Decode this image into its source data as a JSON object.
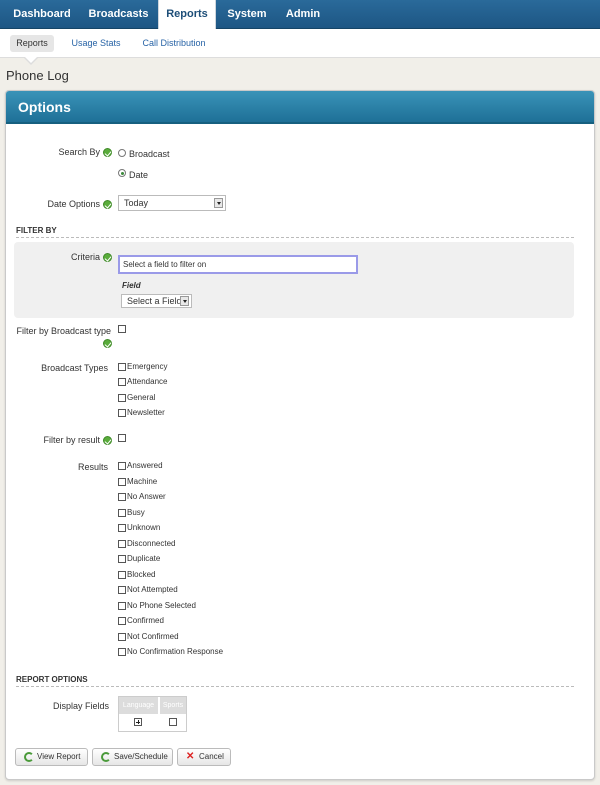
{
  "nav": {
    "tabs": [
      {
        "label": "Dashboard"
      },
      {
        "label": "Broadcasts"
      },
      {
        "label": "Reports"
      },
      {
        "label": "System"
      },
      {
        "label": "Admin"
      }
    ],
    "active_tab": "Reports"
  },
  "subnav": {
    "items": [
      {
        "label": "Reports"
      },
      {
        "label": "Usage Stats"
      },
      {
        "label": "Call Distribution"
      }
    ],
    "active_item": "Reports"
  },
  "page": {
    "title": "Phone Log"
  },
  "panel": {
    "title": "Options"
  },
  "search_by": {
    "label": "Search By",
    "options": [
      {
        "label": "Broadcast",
        "checked": false
      },
      {
        "label": "Date",
        "checked": true
      }
    ]
  },
  "date_options": {
    "label": "Date Options",
    "value": "Today"
  },
  "filter_by": {
    "heading": "FILTER BY",
    "criteria_label": "Criteria",
    "criteria_value": "Select a field to filter on",
    "field_label": "Field",
    "field_select": "Select a Field"
  },
  "broadcast_type_filter": {
    "label": "Filter by Broadcast type",
    "checked": false
  },
  "broadcast_types": {
    "label": "Broadcast Types",
    "items": [
      {
        "label": "Emergency"
      },
      {
        "label": "Attendance"
      },
      {
        "label": "General"
      },
      {
        "label": "Newsletter"
      }
    ]
  },
  "result_filter": {
    "label": "Filter by result",
    "checked": false
  },
  "results": {
    "label": "Results",
    "items": [
      {
        "label": "Answered"
      },
      {
        "label": "Machine"
      },
      {
        "label": "No Answer"
      },
      {
        "label": "Busy"
      },
      {
        "label": "Unknown"
      },
      {
        "label": "Disconnected"
      },
      {
        "label": "Duplicate"
      },
      {
        "label": "Blocked"
      },
      {
        "label": "Not Attempted"
      },
      {
        "label": "No Phone Selected"
      },
      {
        "label": "Confirmed"
      },
      {
        "label": "Not Confirmed"
      },
      {
        "label": "No Confirmation Response"
      }
    ]
  },
  "report_options": {
    "heading": "REPORT OPTIONS",
    "display_fields_label": "Display Fields",
    "columns": [
      {
        "label": "Language"
      },
      {
        "label": "Sports"
      }
    ]
  },
  "buttons": {
    "view_report": "View Report",
    "save_schedule": "Save/Schedule",
    "cancel": "Cancel"
  },
  "colors": {
    "nav": "#1d5684",
    "panel_header": "#2a82a8",
    "ok_icon": "#5aac3b"
  }
}
